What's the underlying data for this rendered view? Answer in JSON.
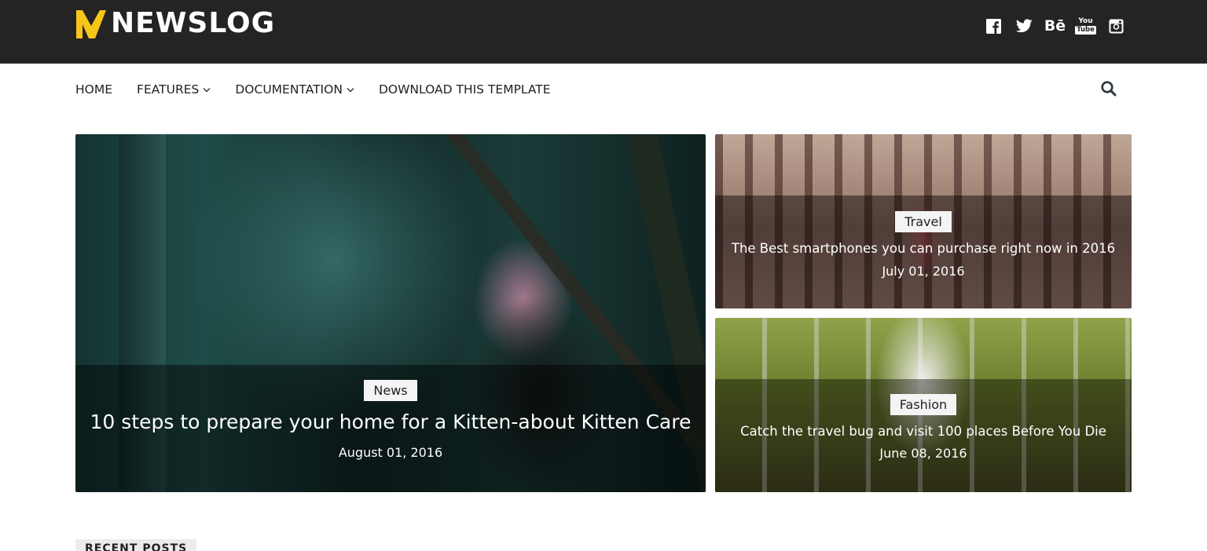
{
  "header": {
    "logo_text": "NEWSLOG",
    "logo_color": "#f5c518",
    "background": "#242424",
    "social": [
      {
        "icon": "facebook-icon"
      },
      {
        "icon": "twitter-icon"
      },
      {
        "icon": "behance-icon",
        "glyph": "Bē"
      },
      {
        "icon": "youtube-icon",
        "glyph_top": "You",
        "glyph_bottom": "Tube"
      },
      {
        "icon": "instagram-icon"
      }
    ]
  },
  "nav": {
    "items": [
      {
        "label": "HOME",
        "dropdown": false
      },
      {
        "label": "FEATURES",
        "dropdown": true
      },
      {
        "label": "DOCUMENTATION",
        "dropdown": true
      },
      {
        "label": "DOWNLOAD THIS TEMPLATE",
        "dropdown": false
      }
    ],
    "search_icon": "search-icon"
  },
  "featured": {
    "main": {
      "tag": "News",
      "title": "10 steps to prepare your home for a Kitten-about Kitten Care",
      "date": "August 01, 2016"
    },
    "side": [
      {
        "tag": "Travel",
        "title": "The Best smartphones you can purchase right now in 2016",
        "date": "July 01, 2016"
      },
      {
        "tag": "Fashion",
        "title": "Catch the travel bug and visit 100 places Before You Die",
        "date": "June 08, 2016"
      }
    ]
  },
  "recent_posts": {
    "label": "RECENT POSTS"
  }
}
